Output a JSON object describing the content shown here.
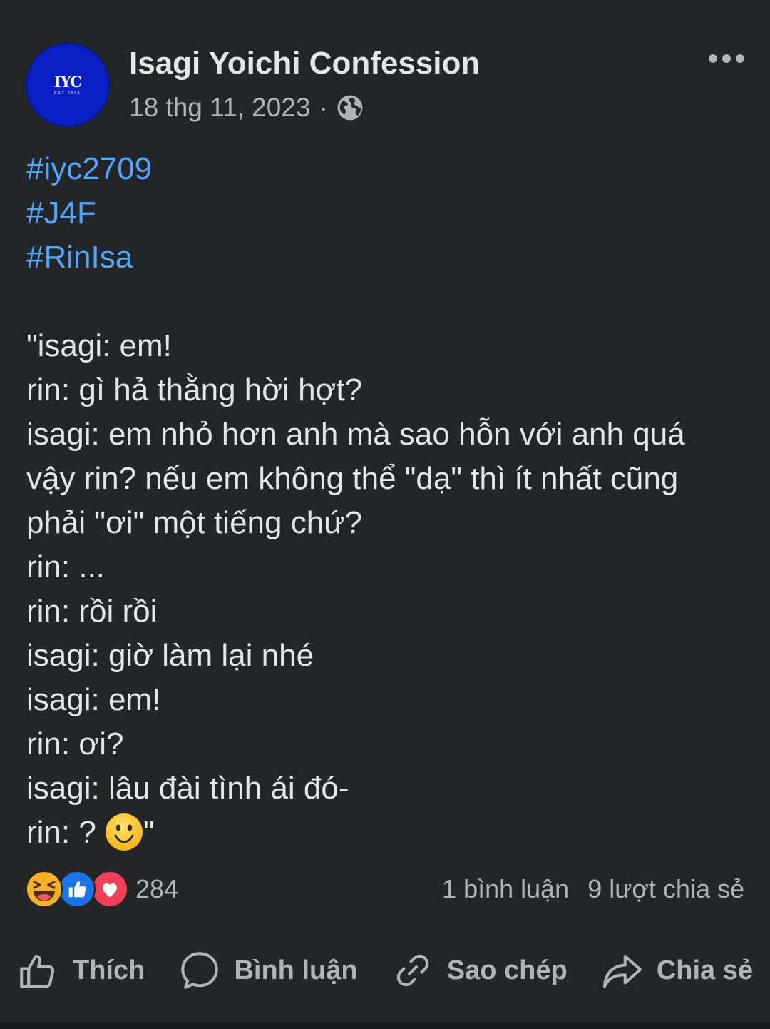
{
  "post": {
    "page_name": "Isagi Yoichi Confession",
    "avatar": {
      "mark": "IYC",
      "sub": "EST 0901",
      "color": "#0a1fc4"
    },
    "date": "18 thg 11, 2023",
    "separator": "·",
    "privacy_icon": "globe-icon",
    "more_icon": "more-options-icon",
    "hashtags": [
      "#iyc2709",
      "#J4F",
      "#RinIsa"
    ],
    "lines": [
      "\"isagi: em!",
      "rin: gì hả thằng hời hợt?",
      "isagi: em nhỏ hơn anh mà sao hỗn với anh quá",
      "vậy rin? nếu em không thể \"dạ\" thì ít nhất cũng",
      "phải \"ơi\" một tiếng chứ?",
      "rin: ...",
      "rin: rồi rồi",
      "isagi: giờ làm lại nhé",
      "isagi: em!",
      "rin: ơi?",
      "isagi: lâu đài tình ái đó-"
    ],
    "last_line_prefix": "rin: ? ",
    "last_line_emoji": "slightly-smiling-face-emoji",
    "last_line_suffix": "\""
  },
  "stats": {
    "reactions": [
      "haha-reaction-icon",
      "like-reaction-icon",
      "love-reaction-icon"
    ],
    "reaction_count": "284",
    "comments": "1 bình luận",
    "shares": "9 lượt chia sẻ"
  },
  "actions": {
    "like": "Thích",
    "comment": "Bình luận",
    "copy": "Sao chép",
    "share": "Chia sẻ"
  },
  "colors": {
    "background": "#242526",
    "text": "#e4e6eb",
    "secondary_text": "#b0b3b8",
    "hashtag": "#4fa6ff"
  }
}
